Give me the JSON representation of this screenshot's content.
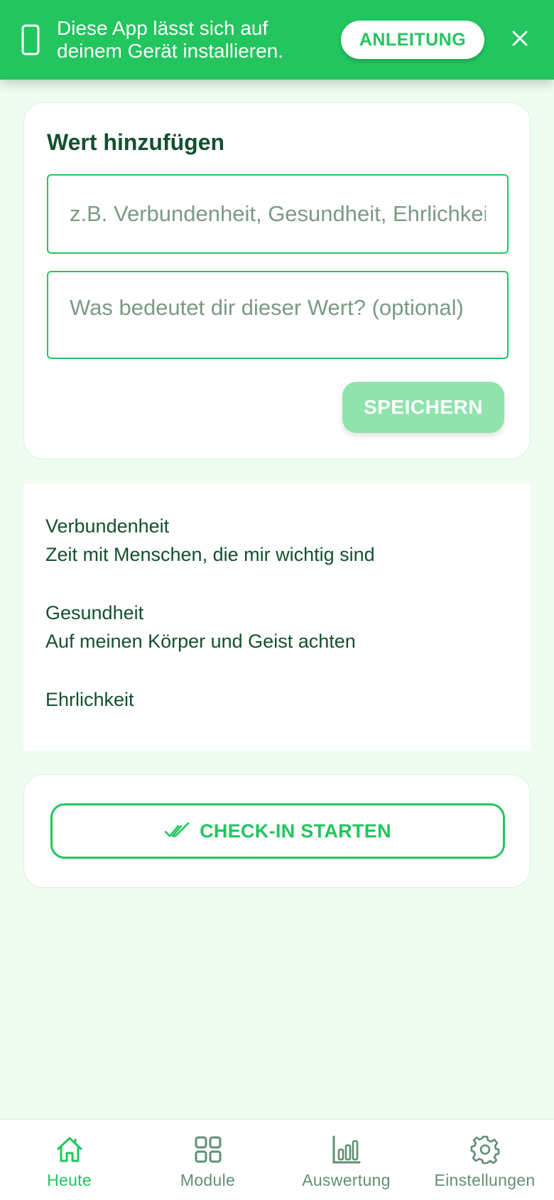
{
  "colors": {
    "accent": "#22c55e",
    "accent_light": "#8fe3ad",
    "text_dark": "#12502e",
    "background": "#eefcf1",
    "nav_inactive": "#5f8f72"
  },
  "banner": {
    "icon": "smartphone-icon",
    "line1": "Diese App lässt sich auf",
    "line2": "deinem Gerät installieren.",
    "guide_label": "ANLEITUNG",
    "close_icon": "close-icon"
  },
  "add_value": {
    "title": "Wert hinzufügen",
    "name_placeholder": "z.B. Verbundenheit, Gesundheit, Ehrlichkeit",
    "description_placeholder": "Was bedeutet dir dieser Wert? (optional)",
    "save_label": "SPEICHERN"
  },
  "values": [
    {
      "title": "Verbundenheit",
      "description": "Zeit mit Menschen, die mir wichtig sind"
    },
    {
      "title": "Gesundheit",
      "description": "Auf meinen Körper und Geist achten"
    },
    {
      "title": "Ehrlichkeit"
    }
  ],
  "checkin": {
    "icon": "double-check-icon",
    "label": "CHECK-IN STARTEN"
  },
  "nav": {
    "items": [
      {
        "label": "Heute",
        "icon": "home-icon",
        "active": true
      },
      {
        "label": "Module",
        "icon": "grid-icon",
        "active": false
      },
      {
        "label": "Auswertung",
        "icon": "bar-chart-icon",
        "active": false
      },
      {
        "label": "Einstellungen",
        "icon": "gear-icon",
        "active": false
      }
    ]
  }
}
